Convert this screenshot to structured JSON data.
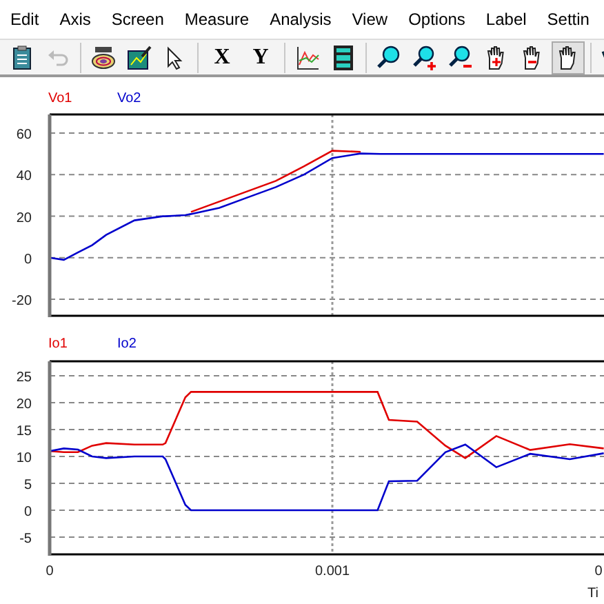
{
  "menu": [
    {
      "label": "Edit"
    },
    {
      "label": "Axis"
    },
    {
      "label": "Screen"
    },
    {
      "label": "Measure"
    },
    {
      "label": "Analysis"
    },
    {
      "label": "View"
    },
    {
      "label": "Options"
    },
    {
      "label": "Label"
    },
    {
      "label": "Settin"
    }
  ],
  "toolbar": [
    {
      "kind": "icon",
      "disabled": false,
      "pressed": false
    },
    {
      "kind": "icon",
      "disabled": true,
      "pressed": false
    },
    {
      "kind": "separator"
    },
    {
      "kind": "icon",
      "disabled": false,
      "pressed": false
    },
    {
      "kind": "icon",
      "disabled": false,
      "pressed": false
    },
    {
      "kind": "icon",
      "disabled": false,
      "pressed": false
    },
    {
      "kind": "separator"
    },
    {
      "kind": "text",
      "label": "X",
      "disabled": false,
      "pressed": false
    },
    {
      "kind": "text",
      "label": "Y",
      "disabled": false,
      "pressed": false
    },
    {
      "kind": "separator"
    },
    {
      "kind": "icon",
      "disabled": false,
      "pressed": false
    },
    {
      "kind": "icon",
      "disabled": false,
      "pressed": false
    },
    {
      "kind": "separator"
    },
    {
      "kind": "icon",
      "disabled": false,
      "pressed": false
    },
    {
      "kind": "icon",
      "disabled": false,
      "pressed": false
    },
    {
      "kind": "icon",
      "disabled": false,
      "pressed": false
    },
    {
      "kind": "icon",
      "disabled": false,
      "pressed": false
    },
    {
      "kind": "icon",
      "disabled": false,
      "pressed": false
    },
    {
      "kind": "icon",
      "disabled": false,
      "pressed": true
    },
    {
      "kind": "separator"
    },
    {
      "kind": "icon",
      "disabled": false,
      "pressed": false
    }
  ],
  "panels": [
    {
      "chart_data": {
        "type": "line",
        "grid": true,
        "ref_lines": [
          {
            "axis": "x",
            "value": 0.001
          }
        ],
        "xlim": [
          0,
          0.002
        ],
        "ylim": [
          -28,
          69
        ],
        "yticks": [
          -20,
          0,
          20,
          40,
          60
        ],
        "x": [
          0,
          5e-05,
          0.0001,
          0.00015,
          0.0002,
          0.0003,
          0.0004,
          0.00041,
          0.00048,
          0.0005,
          0.0006,
          0.0007,
          0.0008,
          0.0009,
          0.001,
          0.0011,
          0.00117,
          0.00118,
          0.00125,
          0.0013,
          0.0014,
          0.0015,
          0.0016,
          0.0017,
          0.0018,
          0.0019,
          0.00196
        ],
        "series": [
          {
            "name": "Vo1",
            "color": "#e00000",
            "values": [
              null,
              null,
              null,
              null,
              null,
              null,
              null,
              null,
              null,
              22,
              27,
              32,
              37,
              44,
              51.5,
              51,
              null,
              null,
              null,
              null,
              null,
              null,
              null,
              null,
              null,
              null,
              null
            ]
          },
          {
            "name": "Vo2",
            "color": "#0000cc",
            "values": [
              0,
              -1,
              2.5,
              6,
              11,
              18,
              20,
              20,
              20.5,
              21,
              24,
              29,
              34,
              40,
              48,
              50.2,
              50,
              50,
              50,
              50,
              50,
              50,
              50,
              50,
              50,
              50,
              50
            ]
          }
        ]
      }
    },
    {
      "chart_data": {
        "type": "line",
        "grid": true,
        "ref_lines": [
          {
            "axis": "x",
            "value": 0.001
          }
        ],
        "xlabel": "Ti",
        "xlim": [
          0,
          0.002
        ],
        "ylim": [
          -8.2,
          27.7
        ],
        "xticks": [
          {
            "value": 0,
            "label": "0"
          },
          {
            "value": 0.001,
            "label": "0.001"
          },
          {
            "value": 0.002,
            "label": "0"
          }
        ],
        "yticks": [
          -5,
          0,
          5,
          10,
          15,
          20,
          25
        ],
        "x": [
          0,
          5e-05,
          0.0001,
          0.00015,
          0.0002,
          0.0003,
          0.0004,
          0.00041,
          0.00048,
          0.0005,
          0.0006,
          0.0007,
          0.0008,
          0.0009,
          0.001,
          0.0011,
          0.00116,
          0.0012,
          0.0013,
          0.0014,
          0.00147,
          0.00158,
          0.0017,
          0.00184,
          0.00196
        ],
        "series": [
          {
            "name": "Io1",
            "color": "#e00000",
            "values": [
              11,
              10.8,
              10.8,
              12,
              12.5,
              12.2,
              12.2,
              12.5,
              21,
              22,
              22,
              22,
              22,
              22,
              22,
              22,
              22,
              16.8,
              16.5,
              12,
              9.7,
              13.8,
              11.2,
              12.3,
              11.5
            ]
          },
          {
            "name": "Io2",
            "color": "#0000cc",
            "values": [
              11,
              11.5,
              11.3,
              10,
              9.7,
              10,
              10,
              9.5,
              1,
              0,
              0,
              0,
              0,
              0,
              0,
              0,
              0,
              5.4,
              5.5,
              10.8,
              12.2,
              8,
              10.5,
              9.5,
              10.6
            ]
          }
        ]
      }
    }
  ]
}
